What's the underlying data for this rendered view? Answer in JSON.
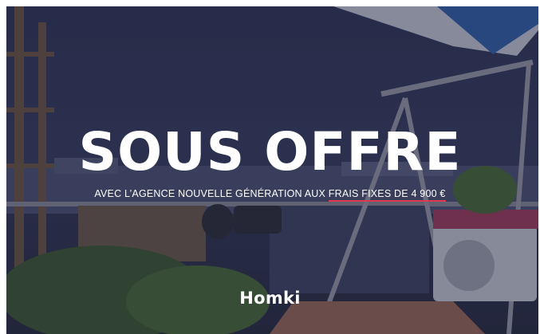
{
  "banner": {
    "headline": "SOUS OFFRE",
    "subline_prefix": "AVEC L’AGENCE NOUVELLE GÉNÉRATION AUX ",
    "subline_highlight": "FRAIS FIXES DE 4 900 €",
    "logo_text": "Homki"
  },
  "colors": {
    "overlay": "#1c203a",
    "text": "#ffffff",
    "highlight_underline": "#e0394f"
  }
}
